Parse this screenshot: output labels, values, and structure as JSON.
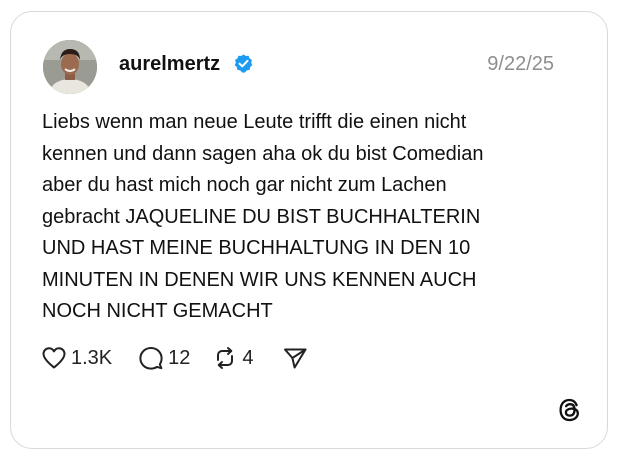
{
  "post": {
    "username": "aurelmertz",
    "date": "9/22/25",
    "text": "Liebs wenn man neue Leute trifft die einen nicht\nkennen und dann sagen aha ok du bist Comedian\naber du hast mich noch gar nicht zum Lachen\ngebracht JAQUELINE DU BIST BUCHHALTERIN\nUND HAST MEINE BUCHHALTUNG IN DEN 10\nMINUTEN IN DENEN WIR UNS KENNEN AUCH\nNOCH NICHT GEMACHT",
    "verified": true
  },
  "actions": {
    "likes": "1.3K",
    "replies": "12",
    "reposts": "4"
  },
  "icons": {
    "like": "heart-icon",
    "reply": "comment-bubble-icon",
    "repost": "repost-icon",
    "share": "send-icon",
    "brand": "threads-logo-icon",
    "verified": "verified-badge-icon"
  },
  "colors": {
    "verified_badge": "#1d9bf0",
    "text": "#111111",
    "muted": "#8e8e8e",
    "border": "#d9d9d9"
  }
}
